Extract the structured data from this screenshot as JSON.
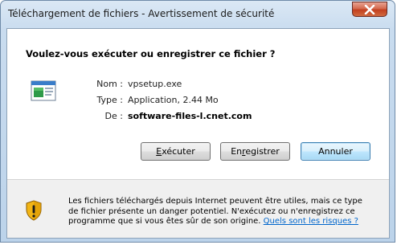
{
  "window": {
    "title": "Téléchargement de fichiers - Avertissement de sécurité",
    "close_icon": "close-icon"
  },
  "dialog": {
    "question": "Voulez-vous exécuter ou enregistrer ce fichier ?",
    "file_icon": "application-file-icon",
    "fields": {
      "name_label": "Nom :",
      "name_value": "vpsetup.exe",
      "type_label": "Type :",
      "type_value": "Application, 2.44 Mo",
      "from_label": "De :",
      "from_value": "software-files-l.cnet.com"
    },
    "buttons": {
      "run_prefix": "",
      "run_accel": "E",
      "run_rest": "xécuter",
      "save_prefix": "En",
      "save_accel": "r",
      "save_rest": "egistrer",
      "cancel": "Annuler"
    }
  },
  "warning": {
    "icon": "shield-warning-icon",
    "line1": "Les fichiers téléchargés depuis Internet peuvent être utiles, mais ce type",
    "line2": "de fichier présente un danger potentiel. N'exécutez ou n'enregistrez ce",
    "line3_text": "programme que si vous êtes sûr de son origine.",
    "link": "Quels sont les risques ?"
  },
  "colors": {
    "link": "#0066cc",
    "close_button": "#c2401f",
    "default_button_border": "#3c7fb1"
  }
}
